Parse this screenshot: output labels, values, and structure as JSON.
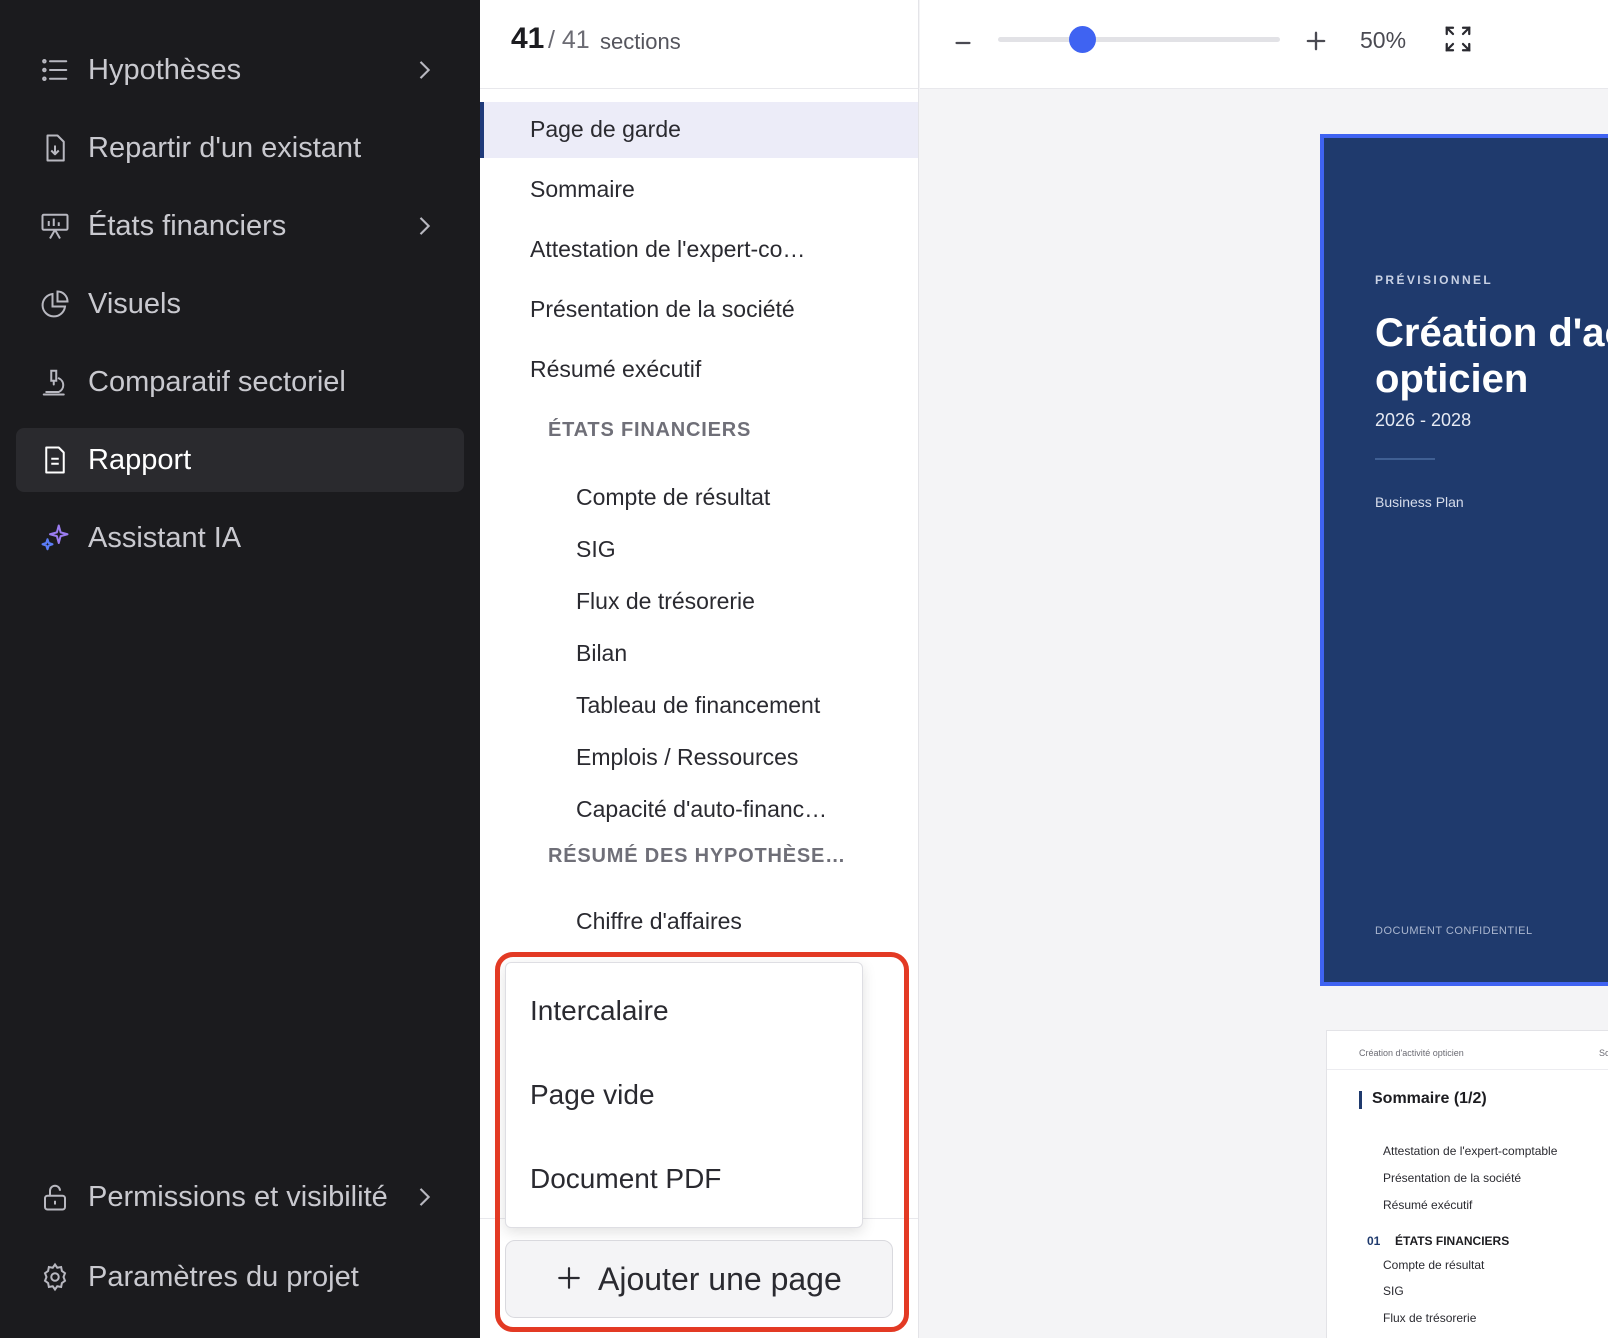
{
  "sidebar": {
    "items": [
      {
        "label": "Hypothèses",
        "icon": "list-icon",
        "chevron": true
      },
      {
        "label": "Repartir d'un existant",
        "icon": "file-import-icon"
      },
      {
        "label": "États financiers",
        "icon": "presentation-icon",
        "chevron": true
      },
      {
        "label": "Visuels",
        "icon": "pie-chart-icon"
      },
      {
        "label": "Comparatif sectoriel",
        "icon": "microscope-icon"
      },
      {
        "label": "Rapport",
        "icon": "document-icon",
        "active": true
      },
      {
        "label": "Assistant IA",
        "icon": "sparkle-icon"
      }
    ],
    "bottom": [
      {
        "label": "Permissions et visibilité",
        "icon": "lock-icon",
        "chevron": true
      },
      {
        "label": "Paramètres du projet",
        "icon": "gear-icon"
      }
    ]
  },
  "sections": {
    "count_current": "41",
    "count_total": "/ 41",
    "count_label": "sections",
    "items": [
      "Page de garde",
      "Sommaire",
      "Attestation de l'expert-co…",
      "Présentation de la société",
      "Résumé exécutif"
    ],
    "group1": "ÉTATS FINANCIERS",
    "group1_items": [
      "Compte de résultat",
      "SIG",
      "Flux de trésorerie",
      "Bilan",
      "Tableau de financement",
      "Emplois / Ressources",
      "Capacité d'auto-financ…"
    ],
    "group2": "RÉSUMÉ DES HYPOTHÈSE…",
    "group2_items": [
      "Chiffre d'affaires"
    ]
  },
  "menu": {
    "items": [
      "Intercalaire",
      "Page vide",
      "Document PDF"
    ],
    "add_label": "Ajouter une page"
  },
  "toolbar": {
    "zoom_value": "50%",
    "zoom_level": 0.3
  },
  "cover": {
    "kicker": "PRÉVISIONNEL",
    "title": "Création d'activité opticien",
    "years": "2026 - 2028",
    "subtitle": "Business Plan",
    "confidential": "DOCUMENT CONFIDENTIEL"
  },
  "page2": {
    "header": "Création d'activité opticien",
    "header_right": "So",
    "title": "Sommaire (1/2)",
    "items": [
      "Attestation de l'expert-comptable",
      "Présentation de la société",
      "Résumé exécutif"
    ],
    "group_num": "01",
    "group_label": "ÉTATS FINANCIERS",
    "group_items": [
      "Compte de résultat",
      "SIG",
      "Flux de trésorerie"
    ]
  },
  "colors": {
    "accent": "#3f63f2",
    "cover": "#1f3a6d",
    "highlight": "#e33a24"
  }
}
